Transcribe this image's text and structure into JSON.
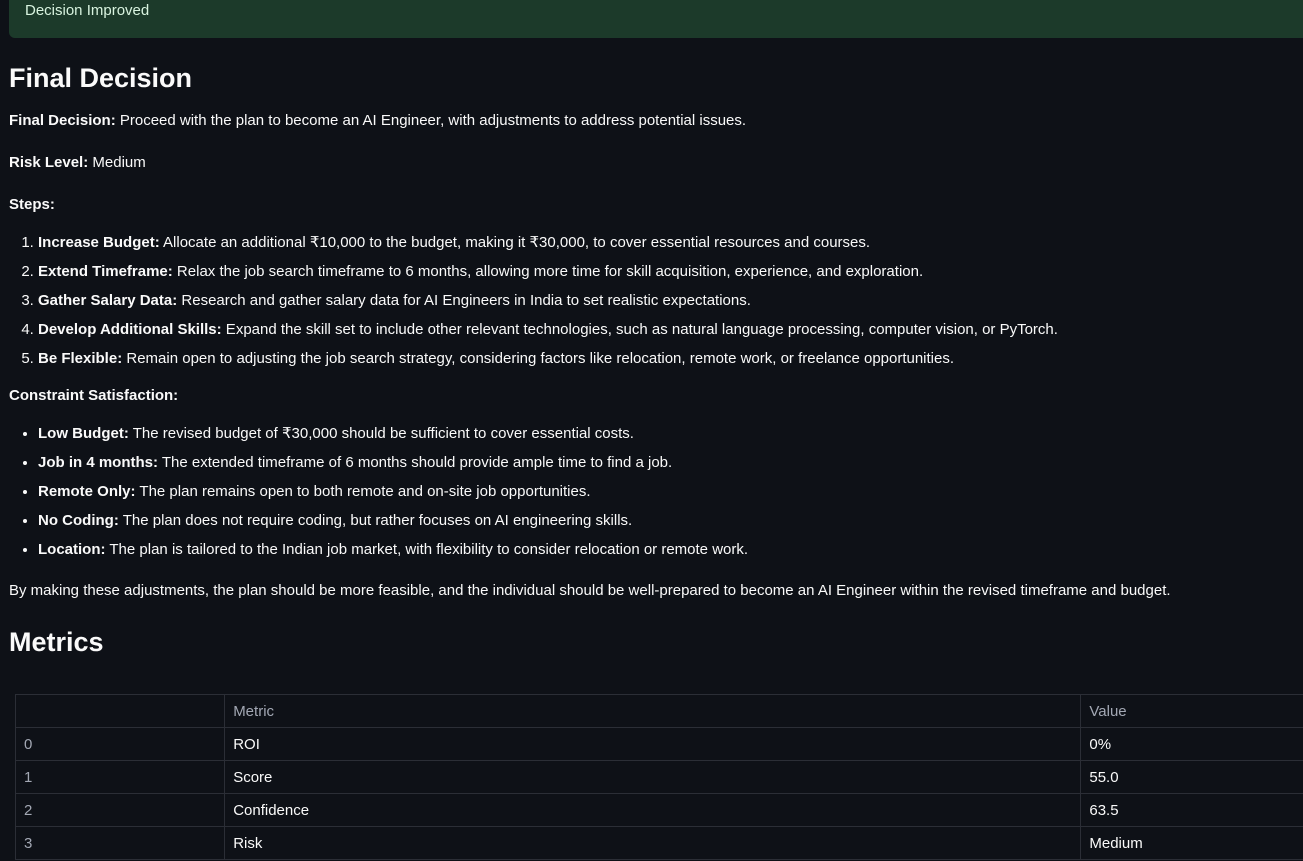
{
  "banner": {
    "text": "Decision Improved",
    "background": "#1c3a2a"
  },
  "final_decision": {
    "heading": "Final Decision",
    "decision_label": "Final Decision:",
    "decision_text": " Proceed with the plan to become an AI Engineer, with adjustments to address potential issues.",
    "risk_label": "Risk Level:",
    "risk_text": " Medium",
    "steps_label": "Steps:",
    "steps": [
      {
        "label": "Increase Budget:",
        "text": " Allocate an additional ₹10,000 to the budget, making it ₹30,000, to cover essential resources and courses."
      },
      {
        "label": "Extend Timeframe:",
        "text": " Relax the job search timeframe to 6 months, allowing more time for skill acquisition, experience, and exploration."
      },
      {
        "label": "Gather Salary Data:",
        "text": " Research and gather salary data for AI Engineers in India to set realistic expectations."
      },
      {
        "label": "Develop Additional Skills:",
        "text": " Expand the skill set to include other relevant technologies, such as natural language processing, computer vision, or PyTorch."
      },
      {
        "label": "Be Flexible:",
        "text": " Remain open to adjusting the job search strategy, considering factors like relocation, remote work, or freelance opportunities."
      }
    ],
    "constraint_label": "Constraint Satisfaction:",
    "constraints": [
      {
        "label": "Low Budget:",
        "text": " The revised budget of ₹30,000 should be sufficient to cover essential costs."
      },
      {
        "label": "Job in 4 months:",
        "text": " The extended timeframe of 6 months should provide ample time to find a job."
      },
      {
        "label": "Remote Only:",
        "text": " The plan remains open to both remote and on-site job opportunities."
      },
      {
        "label": "No Coding:",
        "text": " The plan does not require coding, but rather focuses on AI engineering skills."
      },
      {
        "label": "Location:",
        "text": " The plan is tailored to the Indian job market, with flexibility to consider relocation or remote work."
      }
    ],
    "conclusion": "By making these adjustments, the plan should be more feasible, and the individual should be well-prepared to become an AI Engineer within the revised timeframe and budget."
  },
  "metrics": {
    "heading": "Metrics",
    "columns": [
      "",
      "Metric",
      "Value"
    ],
    "rows": [
      {
        "index": "0",
        "metric": "ROI",
        "value": "0%"
      },
      {
        "index": "1",
        "metric": "Score",
        "value": "55.0"
      },
      {
        "index": "2",
        "metric": "Confidence",
        "value": "63.5"
      },
      {
        "index": "3",
        "metric": "Risk",
        "value": "Medium"
      }
    ]
  }
}
